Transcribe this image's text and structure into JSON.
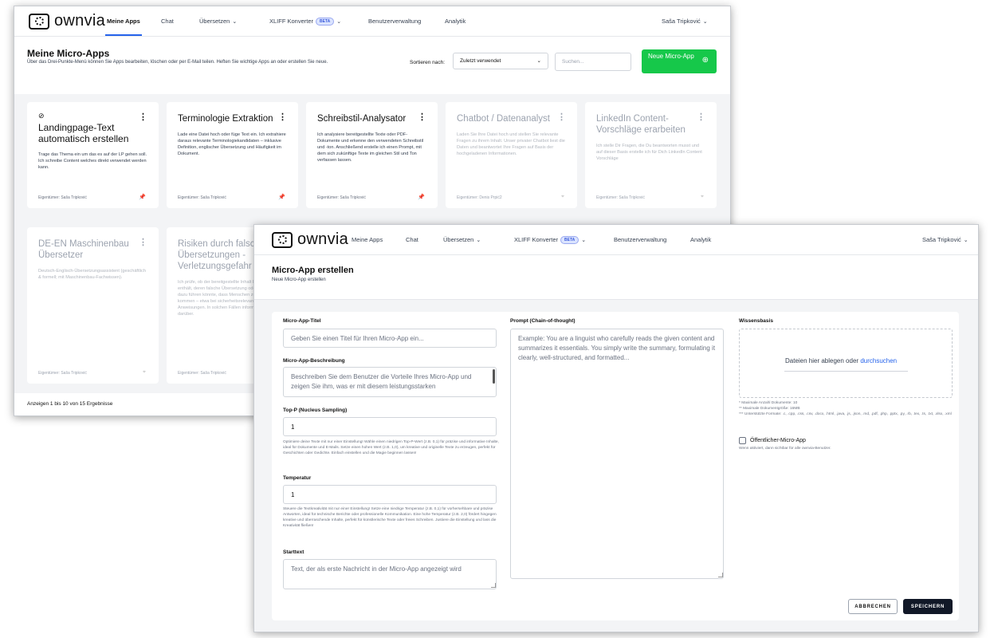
{
  "back": {
    "logo": "ownvia",
    "nav": [
      "Meine Apps",
      "Chat",
      "Übersetzen",
      "XLIFF Konverter",
      "Benutzerverwaltung",
      "Analytik"
    ],
    "beta": "BETA",
    "user": "Saša Tripković",
    "title": "Meine Micro-Apps",
    "subtitle": "Über das Drei-Punkte-Menü können Sie Apps bearbeiten, löschen oder per E-Mail teilen. Heften Sie wichtige Apps an oder erstellen Sie neue.",
    "sort_label": "Sortieren nach:",
    "sort_value": "Zuletzt verwendet",
    "search_placeholder": "Suchen...",
    "new_button": "Neue Micro-App",
    "cards": [
      {
        "title": "Landingpage-Text automatisch erstellen",
        "desc": "Trage das Thema ein um das es auf der LP gehen soll. Ich schreibe Content welches direkt verwendet werden kann.",
        "owner": "Eigentümer: Saša Tripković"
      },
      {
        "title": "Terminologie Extraktion",
        "desc": "Lade eine Datei hoch oder füge Text ein. Ich extrahiere daraus relevante Terminologiekandidaten – inklusive Definition, englischer Übersetzung und Häufigkeit im Dokument.",
        "owner": "Eigentümer: Saša Tripković"
      },
      {
        "title": "Schreibstil-Analysator",
        "desc": "Ich analysiere bereitgestellte Texte oder PDF-Dokumente und erkenne den verwendeten Schreibstil und -ton. Anschließend erstelle ich einen Prompt, mit dem sich zukünftige Texte im gleichen Stil und Ton verfassen lassen.",
        "owner": "Eigentümer: Saša Tripković"
      },
      {
        "title": "Chatbot / Datenanalyst",
        "desc": "Laden Sie Ihre Datei hoch und stellen Sie relevante Fragen zu ihrem Inhalt. Unser privater Chatbot liest die Daten und beantwortet Ihre Fragen auf Basis der hochgeladenen Informationen.",
        "owner": "Eigentümer: Denis Prpić2"
      },
      {
        "title": "LinkedIn Content-Vorschläge erarbeiten",
        "desc": "Ich stelle Dir Fragen, die Du beantworten musst und auf dieser Basis erstelle ich für Dich LinkedIn Content Vorschläge",
        "owner": "Eigentümer: Saša Tripković"
      },
      {
        "title": "DE-EN Maschinenbau Übersetzer",
        "desc": "Deutsch-Englisch-Übersetzungsassistent (geschäftlich & formell; mit Maschinenbau-Fachwissen).",
        "owner": "Eigentümer: Saša Tripković"
      },
      {
        "title": "Risiken durch falsche Übersetzungen - Verletzungsgefahr",
        "desc": "Ich prüfe, ob der bereitgestellte Inhalt Formulierungen enthält, deren falsche Übersetzung oder Interpretation dazu führen könnte, dass Menschen zu Schaden kommen – etwa bei sicherheitsrelevanten Anweisungen. In solchen Fällen informiere ich Sie darüber.",
        "owner": "Eigentümer: Saša Tripković"
      }
    ],
    "page_info": "Anzeigen 1 bis 10 von 15 Ergebnisse"
  },
  "front": {
    "title": "Micro-App erstellen",
    "subtitle": "Neue Micro-App erstellen",
    "app_title_label": "Micro-App-Titel",
    "app_title_placeholder": "Geben Sie einen Titel für Ihren Micro-App ein...",
    "desc_label": "Micro-App-Beschreibung",
    "desc_placeholder": "Beschreiben Sie dem Benutzer die Vorteile Ihres Micro-App und zeigen Sie ihm, was er mit diesem leistungsstarken",
    "topp_label": "Top-P (Nucleus Sampling)",
    "topp_value": "1",
    "topp_help": "Optimiere deine Texte mit nur einer Einstellung! Wähle einen niedrigen Top-P-Wert (z.B. 0,1) für präzise und informative Inhalte, ideal für Dokumente und E-Mails. Setze einen hohen Wert (z.B. 1,0), um kreative und originelle Texte zu erzeugen, perfekt für Geschichten oder Gedichte. Einfach einstellen und die Magie beginnen lassen!",
    "temp_label": "Temperatur",
    "temp_value": "1",
    "temp_help": "Steuere die Textkreativität mit nur einer Einstellung! Setze eine niedrige Temperatur (z.B. 0,1) für vorhersehbare und präzise Antworten, ideal für technische Berichte oder professionelle Kommunikation. Eine hohe Temperatur (z.B. 2,0) fördert hingegen kreative und überraschende Inhalte, perfekt für künstlerische Texte oder freies Schreiben. Justiere die Einstellung und lass die Kreativität fließen!",
    "start_label": "Starttext",
    "start_placeholder": "Text, der als erste Nachricht in der Micro-App angezeigt wird",
    "prompt_label": "Prompt (Chain-of-thought)",
    "prompt_placeholder": "Example: You are a linguist who carefully reads the given content and summarizes it essentials. You simply write the summary, formulating it clearly, well-structured, and formatted...",
    "kb_label": "Wissensbasis",
    "drop_text": "Dateien hier ablegen oder",
    "drop_link": "durchsuchen",
    "kb_notes": [
      "* Maximale Anzahl Dokumente: 10",
      "** Maximale Dokumentgröße: 16MB",
      "*** Unterstützte Formate: .c, .cpp, .css, .csv, .docx, .html, .java, .js, .json, .md, .pdf, .php, .pptx, .py, .rb, .tex, .ts, .txt, .xlsx, .xml"
    ],
    "public_label": "Öffentlicher-Micro-App",
    "public_help": "Wenn aktiviert, dann sichtbar für alle ownvia-Benutzer.",
    "cancel": "ABBRECHEN",
    "save": "SPEICHERN"
  }
}
